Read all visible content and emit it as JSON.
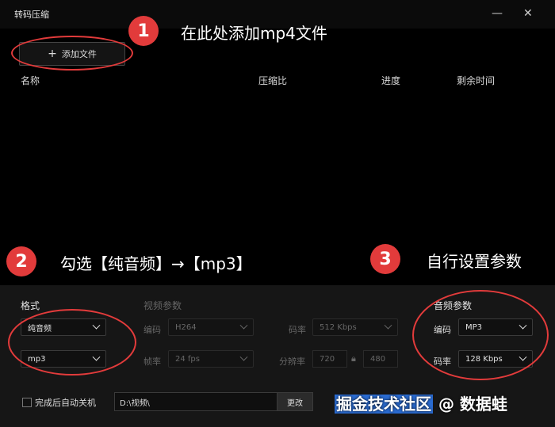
{
  "window": {
    "title": "转码压缩"
  },
  "toolbar": {
    "add_file_label": "添加文件"
  },
  "annotations": [
    {
      "number": "1",
      "text": "在此处添加mp4文件"
    },
    {
      "number": "2",
      "text": "勾选【纯音频】→【mp3】"
    },
    {
      "number": "3",
      "text": "自行设置参数"
    }
  ],
  "file_list": {
    "columns": [
      "名称",
      "压缩比",
      "进度",
      "剩余时间"
    ]
  },
  "format": {
    "title": "格式",
    "type_value": "纯音频",
    "container_value": "mp3"
  },
  "video": {
    "title": "视频参数",
    "codec_label": "编码",
    "codec_value": "H264",
    "bitrate_label": "码率",
    "bitrate_value": "512 Kbps",
    "fps_label": "帧率",
    "fps_value": "24 fps",
    "resolution_label": "分辨率",
    "width": "720",
    "height": "480"
  },
  "audio": {
    "title": "音频参数",
    "codec_label": "编码",
    "codec_value": "MP3",
    "bitrate_label": "码率",
    "bitrate_value": "128 Kbps"
  },
  "footer": {
    "shutdown_label": "完成后自动关机",
    "output_path": "D:\\视频\\",
    "change_label": "更改"
  },
  "watermark": {
    "part1": "掘金技术社区",
    "part2": " @ 数据蛙"
  },
  "colors": {
    "accent": "#e23b3b",
    "background": "#000000",
    "panel": "#161616"
  }
}
